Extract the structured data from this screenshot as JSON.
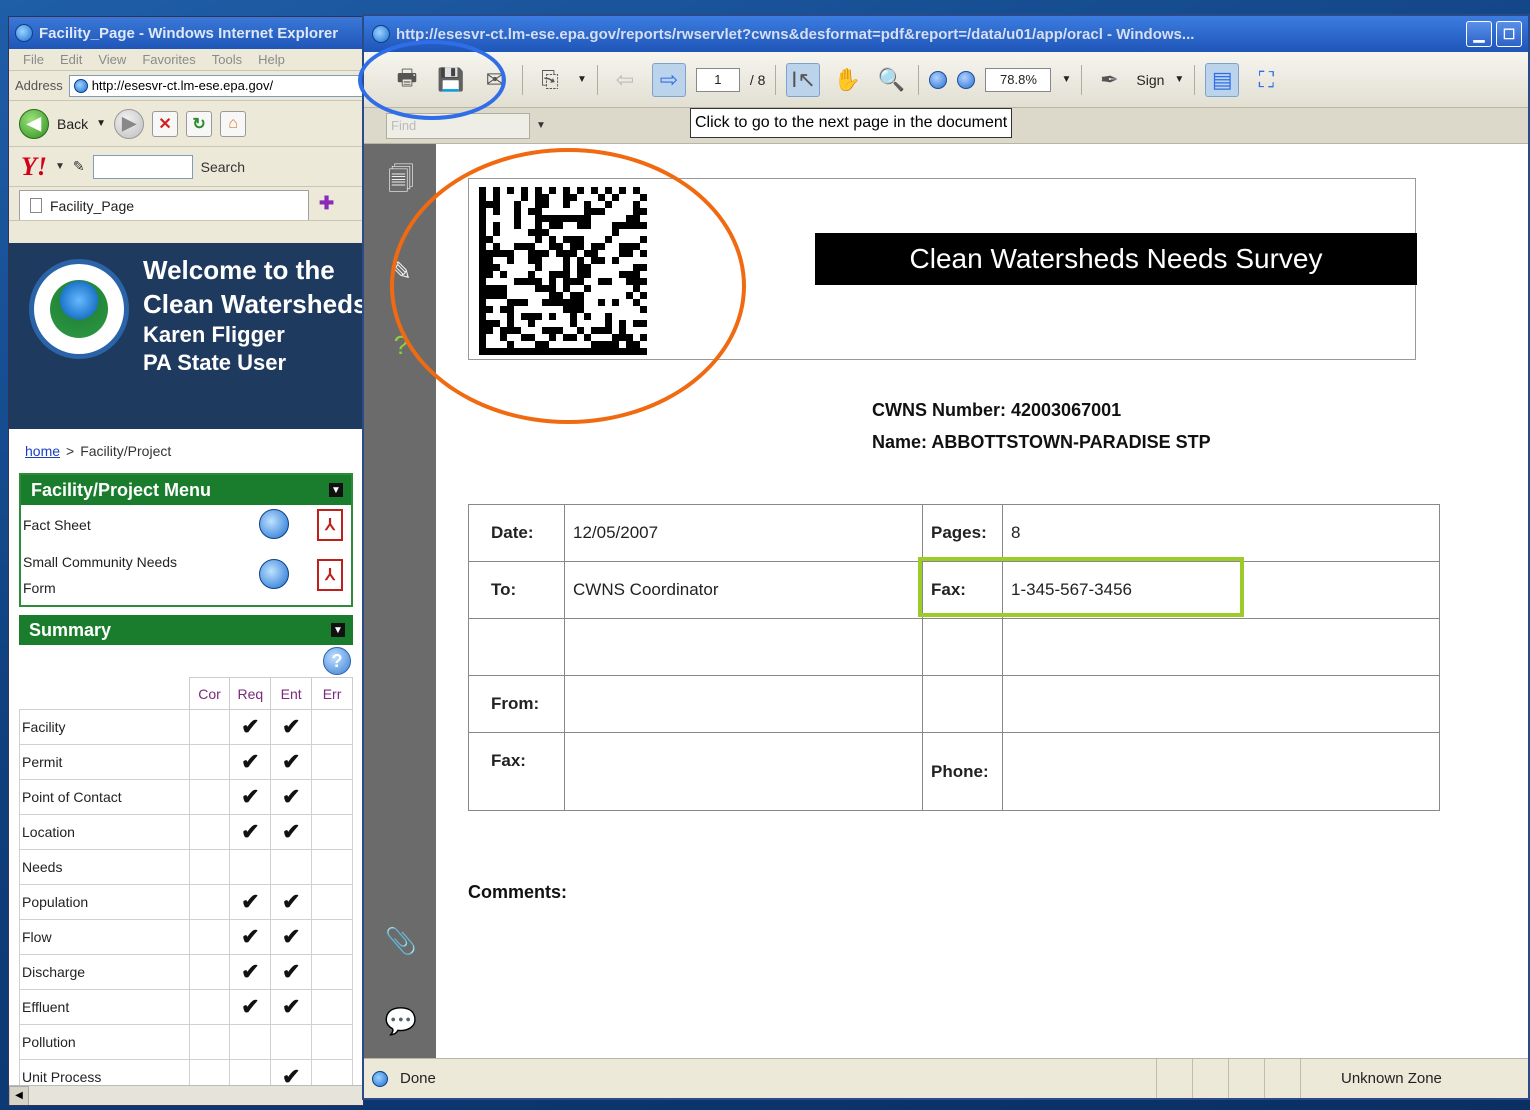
{
  "left_browser": {
    "title": "Facility_Page - Windows Internet Explorer",
    "menu": [
      "File",
      "Edit",
      "View",
      "Favorites",
      "Tools",
      "Help"
    ],
    "address_label": "Address",
    "address_url": "http://esesvr-ct.lm-ese.epa.gov/",
    "back_label": "Back",
    "search_label": "Search",
    "tab_label": "Facility_Page",
    "header": {
      "welcome_line1": "Welcome to the",
      "welcome_line2": "Clean Watersheds",
      "user_name": "Karen Fligger",
      "user_role": "PA State User"
    },
    "breadcrumb": {
      "home": "home",
      "separator": ">",
      "current": "Facility/Project"
    },
    "facility_menu": {
      "title": "Facility/Project Menu",
      "items": [
        {
          "label": "Fact Sheet"
        },
        {
          "label": "Small Community Needs Form"
        }
      ]
    },
    "summary": {
      "title": "Summary",
      "columns": [
        "Cor",
        "Req",
        "Ent",
        "Err"
      ],
      "rows": [
        {
          "name": "Facility",
          "cor": "",
          "req": "✔",
          "ent": "✔",
          "err": ""
        },
        {
          "name": "Permit",
          "cor": "",
          "req": "✔",
          "ent": "✔",
          "err": ""
        },
        {
          "name": "Point of Contact",
          "cor": "",
          "req": "✔",
          "ent": "✔",
          "err": ""
        },
        {
          "name": "Location",
          "cor": "",
          "req": "✔",
          "ent": "✔",
          "err": ""
        },
        {
          "name": "Needs",
          "cor": "",
          "req": "",
          "ent": "",
          "err": ""
        },
        {
          "name": "Population",
          "cor": "",
          "req": "✔",
          "ent": "✔",
          "err": ""
        },
        {
          "name": "Flow",
          "cor": "",
          "req": "✔",
          "ent": "✔",
          "err": ""
        },
        {
          "name": "Discharge",
          "cor": "",
          "req": "✔",
          "ent": "✔",
          "err": ""
        },
        {
          "name": "Effluent",
          "cor": "",
          "req": "✔",
          "ent": "✔",
          "err": ""
        },
        {
          "name": "Pollution",
          "cor": "",
          "req": "",
          "ent": "",
          "err": ""
        },
        {
          "name": "Unit Process",
          "cor": "",
          "req": "",
          "ent": "✔",
          "err": ""
        }
      ]
    }
  },
  "pdf_window": {
    "title": "http://esesvr-ct.lm-ese.epa.gov/reports/rwservlet?cwns&desformat=pdf&report=/data/u01/app/oracl - Windows...",
    "toolbar": {
      "page_current": "1",
      "page_total": "/ 8",
      "zoom": "78.8%",
      "sign_label": "Sign"
    },
    "find_placeholder": "Find",
    "tooltip": "Click to go to the next page in the document",
    "document": {
      "banner": "Clean Watersheds Needs Survey",
      "cwns_number": "CWNS Number: 42003067001",
      "name": "Name: ABBOTTSTOWN-PARADISE STP",
      "fax_table": {
        "date_label": "Date:",
        "date_value": "12/05/2007",
        "pages_label": "Pages:",
        "pages_value": "8",
        "to_label": "To:",
        "to_value": "CWNS Coordinator",
        "fax_label": "Fax:",
        "fax_value": "1-345-567-3456",
        "from_label": "From:",
        "fax2_label": "Fax:",
        "phone_label": "Phone:"
      },
      "comments_label": "Comments:"
    },
    "status": {
      "done": "Done",
      "zone": "Unknown Zone"
    }
  },
  "annotation_colors": {
    "blue": "#2f6ee8",
    "orange": "#f06a12",
    "green": "#9ccb2a"
  }
}
